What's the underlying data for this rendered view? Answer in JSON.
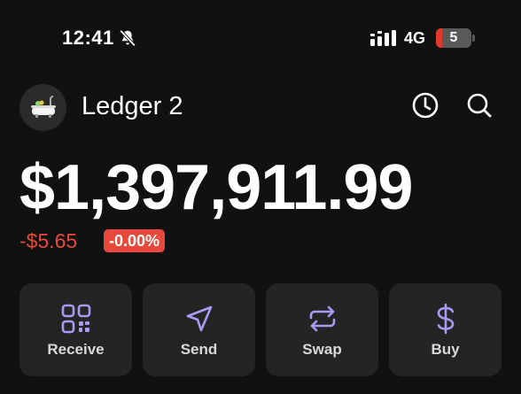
{
  "status_bar": {
    "time": "12:41",
    "network": "4G",
    "battery_level": "5",
    "icons": [
      "bell-slash-icon",
      "signal-icon",
      "battery-icon"
    ]
  },
  "header": {
    "avatar_icon": "bathtub-icon",
    "account_name": "Ledger 2",
    "icons": [
      "clock-icon",
      "search-icon"
    ]
  },
  "balance": {
    "amount": "$1,397,911.99",
    "change": "-$5.65",
    "change_percent": "-0.00%"
  },
  "actions": [
    {
      "label": "Receive",
      "icon": "qr-code-icon"
    },
    {
      "label": "Send",
      "icon": "send-icon"
    },
    {
      "label": "Swap",
      "icon": "swap-icon"
    },
    {
      "label": "Buy",
      "icon": "dollar-icon"
    }
  ],
  "colors": {
    "background": "#111111",
    "card": "#242424",
    "accent": "#a79bf2",
    "negative": "#e8493a"
  }
}
